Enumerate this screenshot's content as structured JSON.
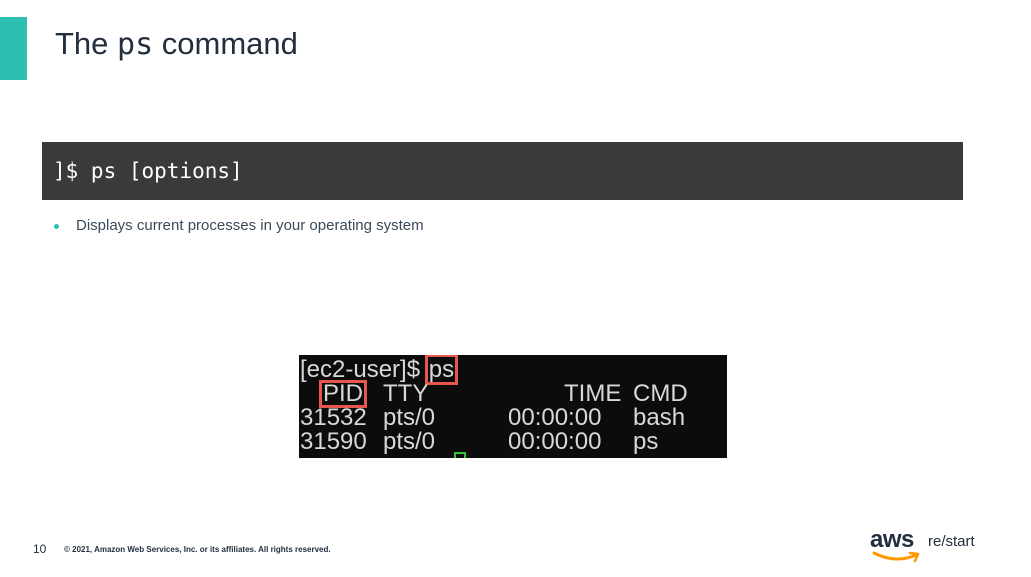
{
  "slide": {
    "title_prefix": "The",
    "title_code": "ps",
    "title_suffix": "command",
    "accent_color": "#2fbfb0"
  },
  "command_bar": {
    "text": "]$ ps [options]"
  },
  "bullets": [
    "Displays current processes in your operating system"
  ],
  "terminal": {
    "prompt": "[ec2-user]$ ",
    "command": "ps",
    "header": {
      "pid": "PID",
      "tty": "TTY",
      "time": "TIME",
      "cmd": "CMD"
    },
    "rows": [
      {
        "pid": "31532",
        "tty": "pts/0",
        "time": "00:00:00",
        "cmd": "bash"
      },
      {
        "pid": "31590",
        "tty": "pts/0",
        "time": "00:00:00",
        "cmd": "ps"
      }
    ],
    "highlight_color": "#e8574d",
    "cursor_color": "#2ec43b"
  },
  "footer": {
    "page_number": "10",
    "copyright": "© 2021, Amazon Web Services, Inc. or its affiliates. All rights reserved.",
    "logo_text": "aws",
    "brand_text": "re/start",
    "smile_color": "#ff9900"
  }
}
